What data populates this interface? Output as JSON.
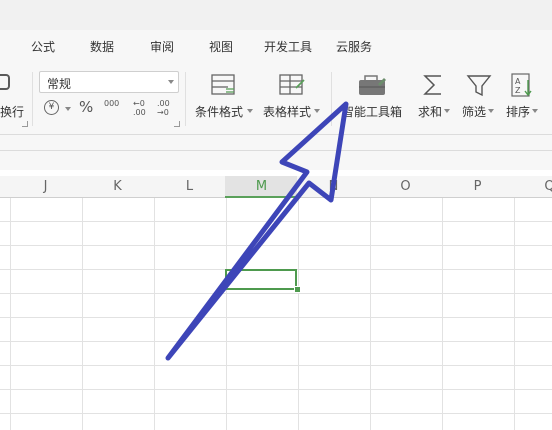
{
  "menu": {
    "items": [
      {
        "label": "公式"
      },
      {
        "label": "数据"
      },
      {
        "label": "审阅"
      },
      {
        "label": "视图"
      },
      {
        "label": "开发工具"
      },
      {
        "label": "云服务"
      }
    ]
  },
  "ribbon": {
    "wrap_text_label": "换行",
    "number_format_value": "常规",
    "currency_symbol": "¥",
    "percent_symbol": "%",
    "thousands_symbol": "000",
    "increase_decimal": "←0 .00",
    "decrease_decimal": ".00 →0",
    "conditional_format_label": "条件格式",
    "table_style_label": "表格样式",
    "smart_toolbox_label": "智能工具箱",
    "sum_label": "求和",
    "filter_label": "筛选",
    "sort_label": "排序"
  },
  "grid": {
    "columns": [
      "J",
      "K",
      "L",
      "M",
      "N",
      "O",
      "P",
      "Q"
    ],
    "selected_column": "M"
  },
  "colors": {
    "accent_green": "#4e9a4e",
    "arrow_blue": "#3d45b8"
  }
}
